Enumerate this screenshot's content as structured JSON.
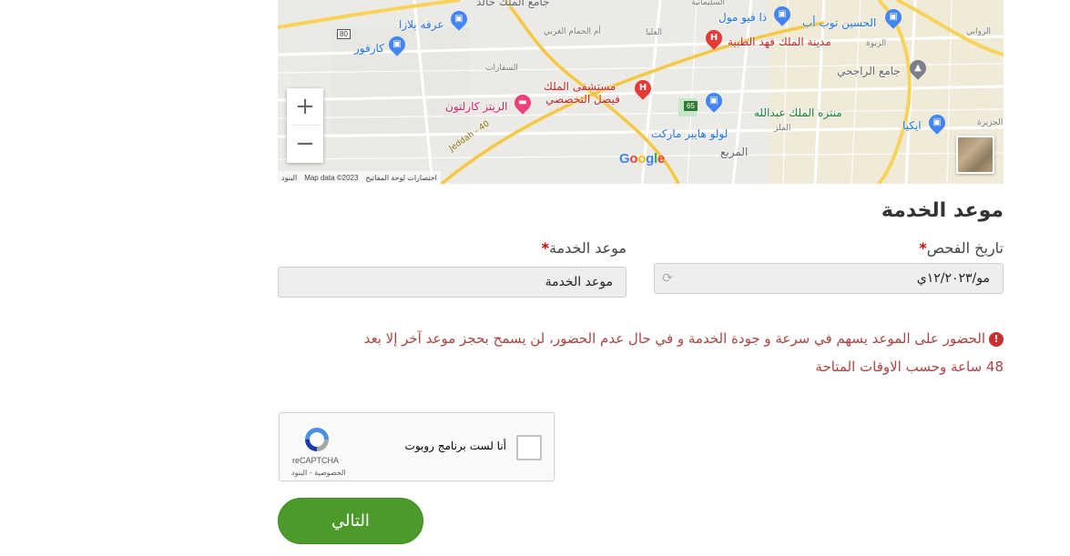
{
  "map": {
    "zoom_in_label": "+",
    "zoom_out_label": "−",
    "google_letters": [
      {
        "t": "G",
        "c": "#4285F4"
      },
      {
        "t": "o",
        "c": "#EA4335"
      },
      {
        "t": "o",
        "c": "#FBBC05"
      },
      {
        "t": "g",
        "c": "#4285F4"
      },
      {
        "t": "l",
        "c": "#34A853"
      },
      {
        "t": "e",
        "c": "#EA4335"
      }
    ],
    "footer": {
      "terms": "البنود",
      "data": "Map data ©2023",
      "shortcuts": "اختصارات لوحة المفاتيح"
    },
    "road_badges": {
      "r80": "80",
      "r65": "65",
      "jeddah": "Jeddah - 40"
    },
    "places": {
      "jamie_khalid": "جامع الملك خالد",
      "arafah_plaza": "عرفه بلازا",
      "carrefour": "كارفور",
      "view_mall": "ذا فيو مول",
      "hussein_tob": "الحسين توب أب",
      "fahd_medical": "مدينة الملك فهد الطبية",
      "rajhi_mosque": "جامع الراجحي",
      "faisal_hospital_1": "مستشفى الملك",
      "faisal_hospital_2": "فيصل التخصصي",
      "ritz": "الريتز كارلتون",
      "abdullah_park": "منتزه الملك عبدالله",
      "lulu": "لولو هايبر ماركت",
      "ikea": "ايكيا",
      "murabba": "المربع",
      "olaya": "العليا",
      "sulaimaniyah": "السليمانية",
      "hammam": "أم الحمام الغربي",
      "safarat": "السفارات",
      "rabwa": "الربوة",
      "rawabi": "الروابي",
      "malaz": "الملز",
      "jazeera": "الجزيرة"
    }
  },
  "form": {
    "section_title": "موعد الخدمة",
    "exam_date_label": "تاريخ الفحص",
    "exam_date_value": "مو/١٢/٢٠٢٣ي",
    "service_time_label": "موعد الخدمة",
    "service_time_value": "موعد الخدمة",
    "required_mark": "*",
    "notice_line1": "الحضور على الموعد يسهم في سرعة و جودة الخدمة و في حال عدم الحضور، لن يسمح بحجز موعد آخر إلا بعد",
    "notice_line2": "48 ساعة وحسب الاوقات المتاحة",
    "warn_icon_glyph": "!"
  },
  "captcha": {
    "label": "أنا لست برنامج روبوت",
    "brand": "reCAPTCHA",
    "links": "الخصوصية - البنود"
  },
  "next_button": "التالي",
  "colors": {
    "accent_green": "#4c9a2a",
    "notice_red": "#a94442",
    "required_red": "#d40000"
  }
}
